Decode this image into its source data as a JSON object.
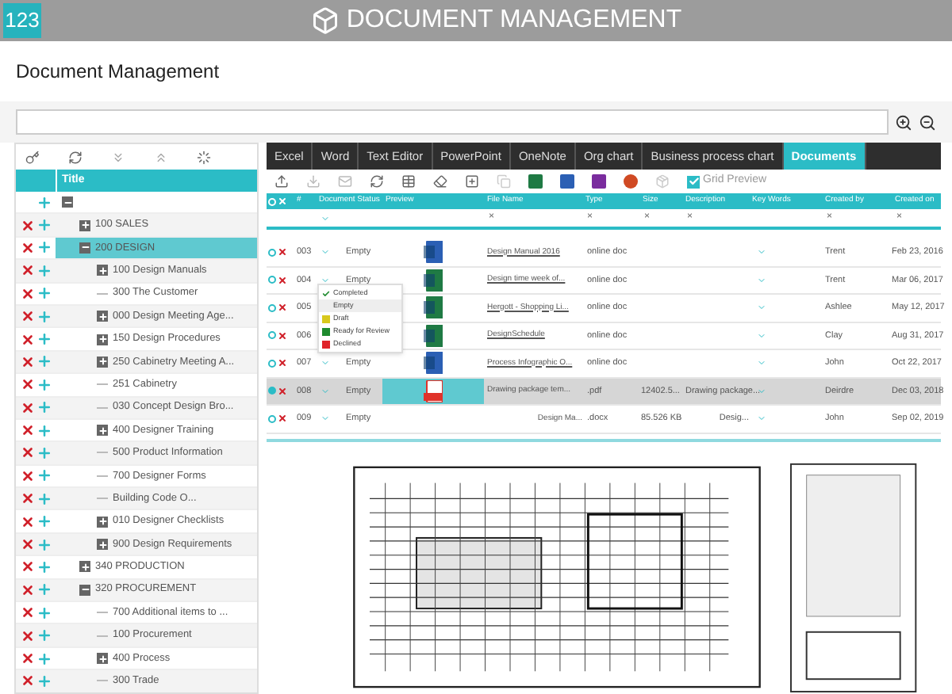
{
  "header": {
    "logo": "123",
    "title": "DOCUMENT MANAGEMENT"
  },
  "page_title": "Document Management",
  "tree": {
    "column": "Title",
    "items": [
      {
        "kind": "folder",
        "expanded": true,
        "selected": false,
        "deletable": false,
        "children": [
          {
            "label": "100  SALES",
            "kind": "folder",
            "expanded": false,
            "selected": false,
            "deletable": true
          },
          {
            "label": "200  DESIGN",
            "kind": "folder",
            "expanded": true,
            "selected": true,
            "deletable": true,
            "children": [
              {
                "label": "100  Design Manuals",
                "kind": "folder",
                "expanded": false,
                "selected": false,
                "deletable": true
              },
              {
                "label": "300  The Customer",
                "kind": "leaf",
                "selected": false,
                "deletable": true
              },
              {
                "label": "000 Design Meeting Age...",
                "kind": "folder",
                "expanded": false,
                "selected": false,
                "deletable": true
              },
              {
                "label": "150  Design Procedures",
                "kind": "folder",
                "expanded": false,
                "selected": false,
                "deletable": true
              },
              {
                "label": "250  Cabinetry Meeting A...",
                "kind": "folder",
                "expanded": false,
                "selected": false,
                "deletable": true
              },
              {
                "label": "251  Cabinetry",
                "kind": "leaf",
                "selected": false,
                "deletable": true
              },
              {
                "label": "030  Concept Design Bro...",
                "kind": "leaf",
                "selected": false,
                "deletable": true
              },
              {
                "label": "400 Designer Training",
                "kind": "folder",
                "expanded": false,
                "selected": false,
                "deletable": true
              },
              {
                "label": "500 Product Information",
                "kind": "leaf",
                "selected": false,
                "deletable": true
              },
              {
                "label": "700  Designer Forms",
                "kind": "leaf",
                "selected": false,
                "deletable": true
              },
              {
                "label": "Building Code O...",
                "kind": "leaf",
                "selected": false,
                "deletable": true
              },
              {
                "label": "010 Designer Checklists",
                "kind": "folder",
                "expanded": false,
                "selected": false,
                "deletable": true
              },
              {
                "label": "900 Design Requirements",
                "kind": "folder",
                "expanded": false,
                "selected": false,
                "deletable": true
              }
            ]
          },
          {
            "label": "340  PRODUCTION",
            "kind": "folder",
            "expanded": false,
            "selected": false,
            "deletable": true
          },
          {
            "label": "320  PROCUREMENT",
            "kind": "folder",
            "expanded": true,
            "selected": false,
            "deletable": true,
            "children": [
              {
                "label": "700  Additional items to ...",
                "kind": "leaf",
                "selected": false,
                "deletable": true
              },
              {
                "label": "100  Procurement",
                "kind": "leaf",
                "selected": false,
                "deletable": true
              },
              {
                "label": "400 Process",
                "kind": "folder",
                "expanded": false,
                "selected": false,
                "deletable": true
              },
              {
                "label": "300 Trade",
                "kind": "leaf",
                "selected": false,
                "deletable": true
              }
            ]
          }
        ]
      }
    ]
  },
  "tabs": [
    {
      "label": "Excel",
      "selected": false
    },
    {
      "label": "Word",
      "selected": false
    },
    {
      "label": "Text Editor",
      "selected": false
    },
    {
      "label": "PowerPoint",
      "selected": false
    },
    {
      "label": "OneNote",
      "selected": false
    },
    {
      "label": "Org chart",
      "selected": false
    },
    {
      "label": "Business process chart",
      "selected": false
    },
    {
      "label": "Documents",
      "selected": true
    }
  ],
  "grid_preview": {
    "label": "Grid Preview",
    "checked": true
  },
  "grid": {
    "columns": [
      "#",
      "Document Status",
      "Preview",
      "File Name",
      "Type",
      "Size",
      "Description",
      "Key Words",
      "Created by",
      "Created on"
    ],
    "filters": [
      "×",
      "×",
      "×",
      "×",
      "×",
      "×"
    ],
    "rows": [
      {
        "num": "003",
        "status": "Empty",
        "kind": "word",
        "file": "Design Manual 2016",
        "type": "online doc",
        "size": "",
        "description": "",
        "created_by": "Trent",
        "created_on": "Feb 23, 2016",
        "selected": false
      },
      {
        "num": "004",
        "status": "Empty",
        "kind": "excel",
        "file": "Design time week of...",
        "type": "online doc",
        "size": "",
        "description": "",
        "created_by": "Trent",
        "created_on": "Mar 06, 2017",
        "selected": false
      },
      {
        "num": "005",
        "status": "",
        "kind": "excel",
        "file": "Hergott - Shopping Li...",
        "type": "online doc",
        "size": "",
        "description": "",
        "created_by": "Ashlee",
        "created_on": "May 12, 2017",
        "selected": false
      },
      {
        "num": "006",
        "status": "",
        "kind": "excel",
        "file": "DesignSchedule",
        "type": "online doc",
        "size": "",
        "description": "",
        "created_by": "Clay",
        "created_on": "Aug 31, 2017",
        "selected": false
      },
      {
        "num": "007",
        "status": "Empty",
        "kind": "word",
        "file": "Process Infographic O...",
        "type": "online doc",
        "size": "",
        "description": "",
        "created_by": "John",
        "created_on": "Oct 22, 2017",
        "selected": false
      },
      {
        "num": "008",
        "status": "Empty",
        "kind": "pdf",
        "file": "Drawing package tem...",
        "type": ".pdf",
        "size": "12402.5...",
        "description": "Drawing package...",
        "created_by": "Deirdre",
        "created_on": "Dec 03, 2018",
        "selected": true
      },
      {
        "num": "009",
        "status": "Empty",
        "kind": "none",
        "file": "Design Ma...",
        "type": ".docx",
        "size": "85.526 KB",
        "description": "Desig...",
        "created_by": "John",
        "created_on": "Sep 02, 2019",
        "selected": false
      }
    ]
  },
  "status_menu": {
    "options": [
      {
        "label": "Completed",
        "checked": true,
        "selected": false
      },
      {
        "label": "Empty",
        "checked": false,
        "selected": true
      },
      {
        "label": "Draft",
        "checked": false,
        "selected": false,
        "color": "#d8c81c"
      },
      {
        "label": "Ready for Review",
        "checked": false,
        "selected": false,
        "color": "#1e8a2e"
      },
      {
        "label": "Declined",
        "checked": false,
        "selected": false,
        "color": "#e0242a"
      }
    ]
  }
}
